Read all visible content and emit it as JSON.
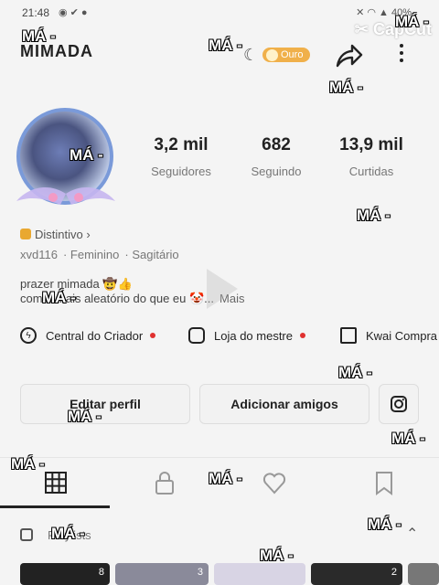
{
  "status_bar": {
    "time": "21:48",
    "battery": "40%"
  },
  "brand": {
    "editor": "CapCut"
  },
  "watermark_text": "MÁ -",
  "profile": {
    "username": "MIMADA",
    "level_badge": "Ouro",
    "stats": [
      {
        "value": "3,2 mil",
        "label": "Seguidores"
      },
      {
        "value": "682",
        "label": "Seguindo"
      },
      {
        "value": "13,9 mil",
        "label": "Curtidas"
      }
    ],
    "distintivo": "Distintivo",
    "meta": [
      "xvd116",
      "Feminino",
      "Sagitário"
    ],
    "bio_line1": "prazer mimada 🤠👍",
    "bio_line2": "com o mais aleatório do que eu 🤡...",
    "bio_more": "Mais"
  },
  "creator_row": [
    {
      "label": "Central do Criador",
      "icon": "lightning-icon",
      "dot": true
    },
    {
      "label": "Loja do mestre",
      "icon": "shop-icon",
      "dot": true
    },
    {
      "label": "Kwai Compra",
      "icon": "bag-icon",
      "dot": false
    }
  ],
  "actions": {
    "edit": "Editar perfil",
    "add_friends": "Adicionar amigos"
  },
  "tabs": [
    "grid-icon",
    "lock-icon",
    "heart-icon",
    "bookmark-icon"
  ],
  "playlists": {
    "label": "Playlists"
  },
  "thumb_counts": [
    "8",
    "3",
    "2"
  ],
  "colors": {
    "badge": "#f0b04a",
    "dot": "#e0312f"
  }
}
